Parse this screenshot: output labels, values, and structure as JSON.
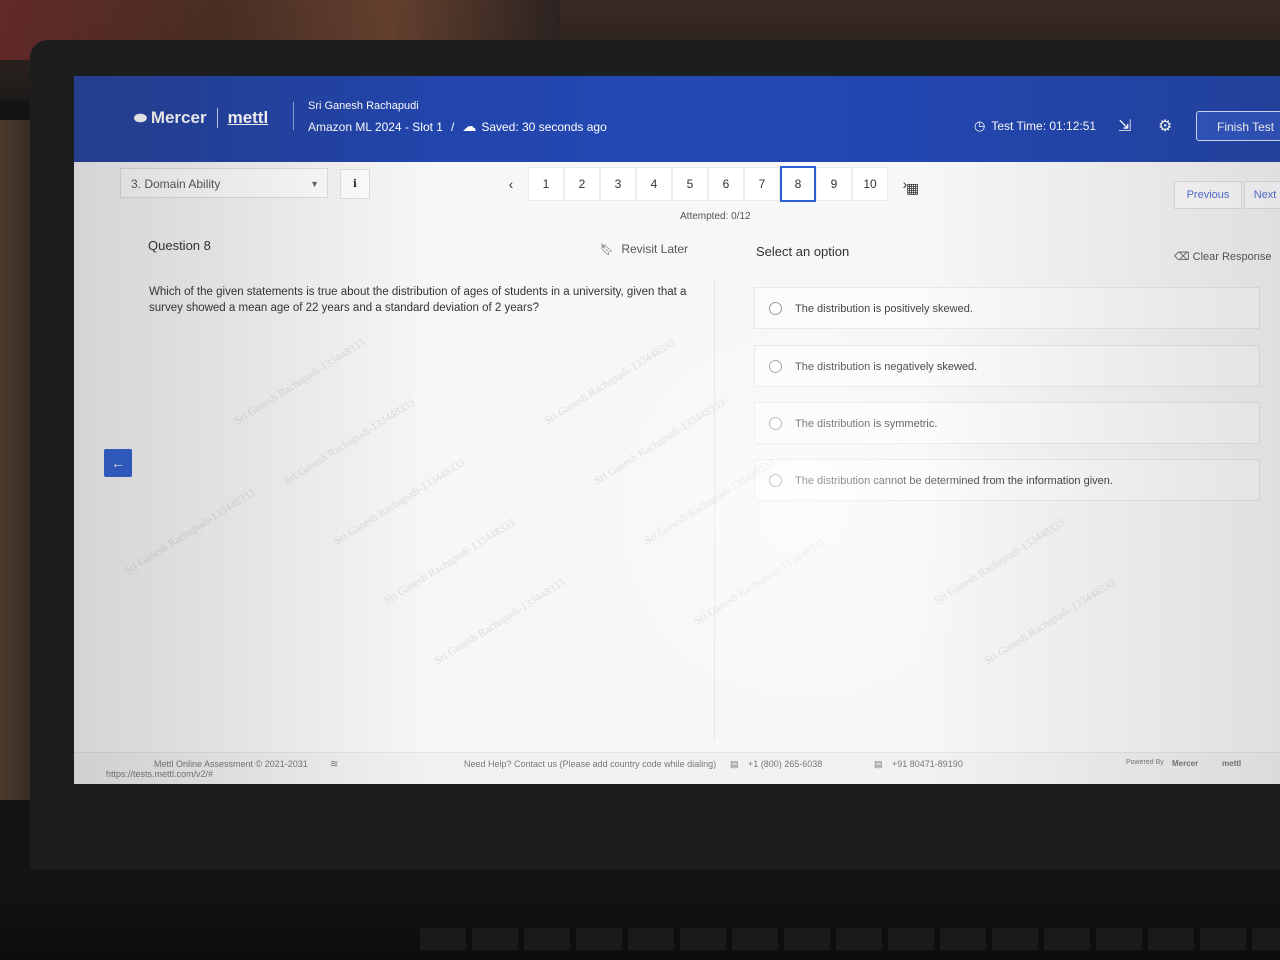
{
  "header": {
    "brand_primary": "Mercer",
    "brand_secondary": "mettl",
    "candidate_name": "Sri Ganesh Rachapudi",
    "exam_title": "Amazon ML 2024 - Slot 1",
    "separator": "/",
    "save_status": "Saved: 30 seconds ago",
    "timer": "Test Time: 01:12:51",
    "finish_label": "Finish Test"
  },
  "nav": {
    "section": "3. Domain Ability",
    "pages": [
      "1",
      "2",
      "3",
      "4",
      "5",
      "6",
      "7",
      "8",
      "9",
      "10"
    ],
    "current_page": "8",
    "attempted": "Attempted: 0/12",
    "prev_label": "Previous",
    "next_label": "Next"
  },
  "question": {
    "title": "Question 8",
    "revisit_label": "Revisit Later",
    "text": "Which of the given statements is true about the distribution of ages of students in a university, given that a survey showed a mean age of 22 years and a standard deviation of 2 years?"
  },
  "options": {
    "heading": "Select an option",
    "clear_label": "Clear Response",
    "items": [
      "The distribution is positively skewed.",
      "The distribution is negatively skewed.",
      "The distribution is symmetric.",
      "The distribution cannot be determined from the information given."
    ]
  },
  "footer": {
    "copyright": "Mettl Online Assessment © 2021-2031",
    "help": "Need Help? Contact us (Please add country code while dialing)",
    "phone_us": "+1 (800) 265-6038",
    "phone_in": "+91 80471-89190",
    "powered_by": "Powered By",
    "url": "https://tests.mettl.com/v2/#"
  },
  "watermark": "Sri Ganesh Rachapudi-133448333",
  "colors": {
    "header_blue": "#2449b4",
    "accent_blue": "#2c5fd1"
  }
}
